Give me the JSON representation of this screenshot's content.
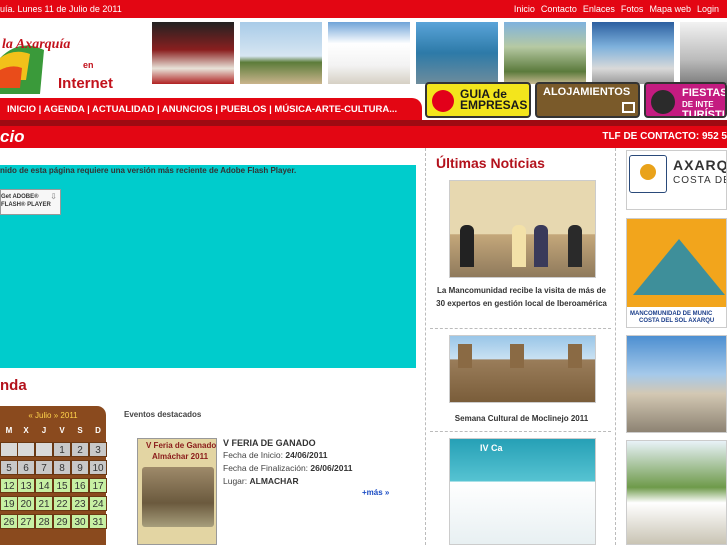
{
  "topbar": {
    "date": "uía. Lunes 11 de Julio de 2011",
    "links": [
      "Inicio",
      "Contacto",
      "Enlaces",
      "Fotos",
      "Mapa web",
      "Login"
    ]
  },
  "logo": {
    "line1": "la Axarquía",
    "line2": "en",
    "line3": "Internet"
  },
  "nav": {
    "items": [
      "INICIO",
      "AGENDA",
      "ACTUALIDAD",
      "ANUNCIOS",
      "PUEBLOS",
      "MÚSICA-ARTE-CULTURA..."
    ],
    "separator": " | "
  },
  "banners": {
    "guia": [
      "GUIA de",
      "EMPRESAS"
    ],
    "alojamientos": [
      "ALOJAMIENTOS"
    ],
    "fiestas": [
      "FIESTAS",
      "DE INTE",
      "TURÍSTIC"
    ]
  },
  "titlebar": {
    "title": "cio",
    "contact": "TLF DE CONTACTO: 952 5"
  },
  "flash": {
    "message": "nido de esta página requiere una versión más reciente de Adobe Flash Player.",
    "button_line1": "Get ADOBE®",
    "button_line2": "FLASH® PLAYER"
  },
  "agenda": {
    "title": "nda",
    "calendar": {
      "prev": "«",
      "month": "Julio",
      "next": "»",
      "year": "2011",
      "weekdays": [
        "M",
        "X",
        "J",
        "V",
        "S",
        "D"
      ],
      "rows": [
        [
          "",
          "",
          "",
          "1",
          "2",
          "3"
        ],
        [
          "5",
          "6",
          "7",
          "8",
          "9",
          "10"
        ],
        [
          "12",
          "13",
          "14",
          "15",
          "16",
          "17"
        ],
        [
          "19",
          "20",
          "21",
          "22",
          "23",
          "24"
        ],
        [
          "26",
          "27",
          "28",
          "29",
          "30",
          "31"
        ]
      ],
      "today": "11"
    }
  },
  "eventos": {
    "title": "Eventos destacados",
    "poster_line1": "V Feria de Ganado",
    "poster_line2": "Almáchar 2011",
    "name": "V FERIA DE GANADO",
    "start_label": "Fecha de Inicio:",
    "start_value": "24/06/2011",
    "end_label": "Fecha de Finalización:",
    "end_value": "26/06/2011",
    "place_label": "Lugar:",
    "place_value": "ALMACHAR",
    "more": "+más »"
  },
  "news": {
    "title": "Últimas Noticias",
    "items": [
      "La Mancomunidad recibe la visita de más de 30 expertos en gestión local de Iberoamérica",
      "Semana Cultural de Moclinejo 2011"
    ],
    "poster3_text": "IV Ca"
  },
  "right": {
    "box1_line1": "AXARQ",
    "box1_line2": "COSTA DE",
    "box2_line1": "MANCOMUNIDAD DE MUNIC",
    "box2_line2": "COSTA DEL SOL AXARQU"
  },
  "colors": {
    "brand_red": "#e30613",
    "dark_red": "#9e0a12",
    "cyan": "#00cccc",
    "calendar_brown": "#8a4a1e",
    "calendar_green": "#c7f0a3"
  }
}
